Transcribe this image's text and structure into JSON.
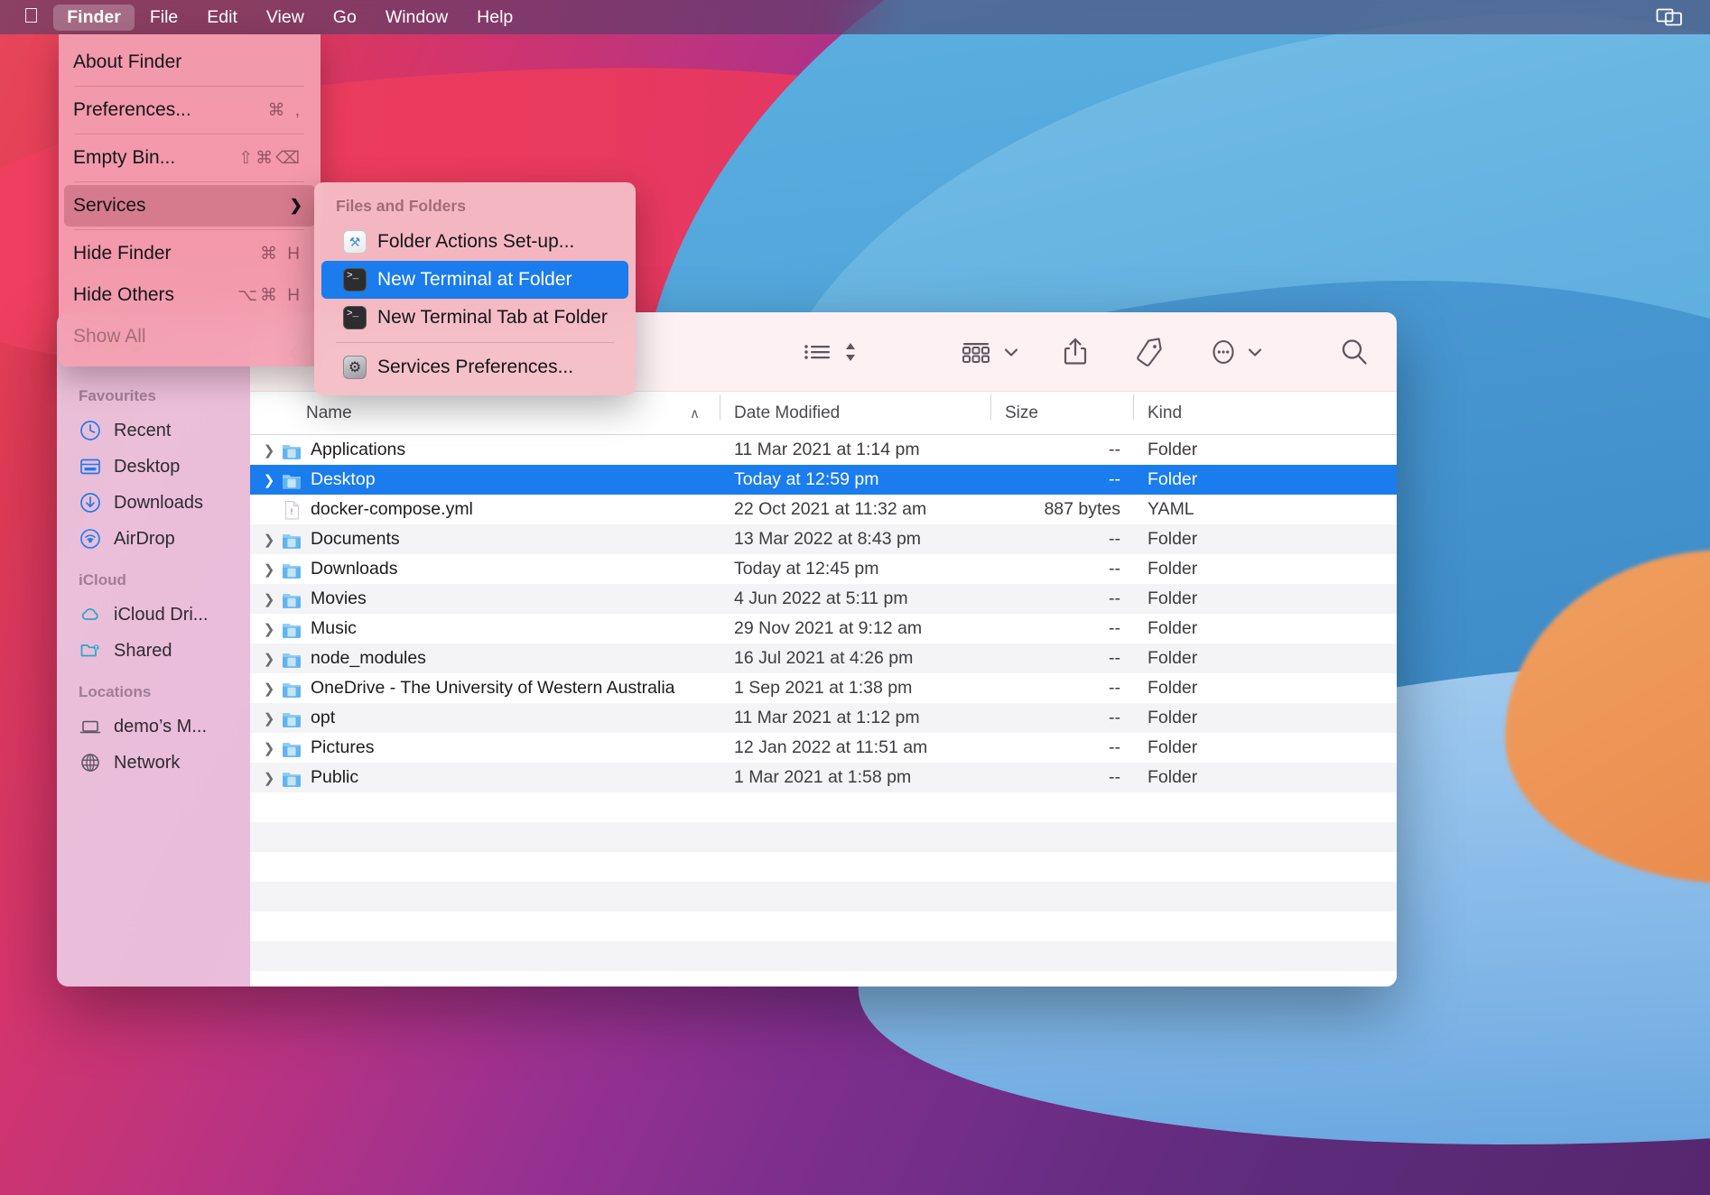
{
  "menubar": {
    "apple_icon": "apple-logo",
    "items": [
      {
        "label": "Finder",
        "bold": true,
        "active": true
      },
      {
        "label": "File",
        "bold": false,
        "active": false
      },
      {
        "label": "Edit",
        "bold": false,
        "active": false
      },
      {
        "label": "View",
        "bold": false,
        "active": false
      },
      {
        "label": "Go",
        "bold": false,
        "active": false
      },
      {
        "label": "Window",
        "bold": false,
        "active": false
      },
      {
        "label": "Help",
        "bold": false,
        "active": false
      }
    ],
    "status_icon": "screen-mirroring-icon"
  },
  "finder_menu": {
    "items": [
      {
        "label": "About Finder",
        "shortcut": "",
        "state": "normal",
        "submenu": false
      },
      {
        "sep": true
      },
      {
        "label": "Preferences...",
        "shortcut": "⌘ ,",
        "state": "normal",
        "submenu": false
      },
      {
        "sep": true
      },
      {
        "label": "Empty Bin...",
        "shortcut": "⇧⌘⌫",
        "state": "normal",
        "submenu": false
      },
      {
        "sep": true
      },
      {
        "label": "Services",
        "shortcut": "",
        "state": "highlighted",
        "submenu": true
      },
      {
        "sep": true
      },
      {
        "label": "Hide Finder",
        "shortcut": "⌘ H",
        "state": "normal",
        "submenu": false
      },
      {
        "label": "Hide Others",
        "shortcut": "⌥⌘ H",
        "state": "normal",
        "submenu": false
      },
      {
        "label": "Show All",
        "shortcut": "",
        "state": "disabled",
        "submenu": false
      }
    ]
  },
  "services_menu": {
    "section_title": "Files and Folders",
    "items": [
      {
        "label": "Folder Actions Set-up...",
        "icon": "folder-actions-icon",
        "selected": false
      },
      {
        "label": "New Terminal at Folder",
        "icon": "terminal-icon",
        "selected": true
      },
      {
        "label": "New Terminal Tab at Folder",
        "icon": "terminal-icon",
        "selected": false
      }
    ],
    "preferences": {
      "label": "Services Preferences...",
      "icon": "gear-icon"
    }
  },
  "window": {
    "traffic_lights": [
      "close",
      "minimise",
      "zoom"
    ],
    "toolbar": {
      "back_label": "‹",
      "icons": [
        {
          "name": "list-view-icon"
        },
        {
          "name": "sort-arrows-icon"
        },
        {
          "name": "group-by-icon"
        },
        {
          "name": "chevron-down-icon"
        },
        {
          "name": "share-icon"
        },
        {
          "name": "tag-icon"
        },
        {
          "name": "more-actions-icon"
        },
        {
          "name": "chevron-down-icon"
        },
        {
          "name": "search-icon"
        }
      ]
    }
  },
  "sidebar": {
    "sections": [
      {
        "title": "Favourites",
        "items": [
          {
            "label": "Recent",
            "icon": "clock-icon"
          },
          {
            "label": "Desktop",
            "icon": "desktop-icon"
          },
          {
            "label": "Downloads",
            "icon": "download-icon"
          },
          {
            "label": "AirDrop",
            "icon": "airdrop-icon"
          }
        ]
      },
      {
        "title": "iCloud",
        "items": [
          {
            "label": "iCloud Dri...",
            "icon": "cloud-icon"
          },
          {
            "label": "Shared",
            "icon": "shared-folder-icon"
          }
        ]
      },
      {
        "title": "Locations",
        "items": [
          {
            "label": "demo’s M...",
            "icon": "laptop-icon"
          },
          {
            "label": "Network",
            "icon": "globe-icon"
          }
        ]
      }
    ]
  },
  "filelist": {
    "columns": [
      "Name",
      "Date Modified",
      "Size",
      "Kind"
    ],
    "sort_indicator": "∧",
    "rows": [
      {
        "name": "Applications",
        "date": "11 Mar 2021 at 1:14 pm",
        "size": "--",
        "kind": "Folder",
        "icon": "folder-applications-icon",
        "expandable": true,
        "selected": false
      },
      {
        "name": "Desktop",
        "date": "Today at 12:59 pm",
        "size": "--",
        "kind": "Folder",
        "icon": "folder-desktop-icon",
        "expandable": true,
        "selected": true
      },
      {
        "name": "docker-compose.yml",
        "date": "22 Oct 2021 at 11:32 am",
        "size": "887 bytes",
        "kind": "YAML",
        "icon": "yaml-file-icon",
        "expandable": false,
        "selected": false
      },
      {
        "name": "Documents",
        "date": "13 Mar 2022 at 8:43 pm",
        "size": "--",
        "kind": "Folder",
        "icon": "folder-documents-icon",
        "expandable": true,
        "selected": false
      },
      {
        "name": "Downloads",
        "date": "Today at 12:45 pm",
        "size": "--",
        "kind": "Folder",
        "icon": "folder-downloads-icon",
        "expandable": true,
        "selected": false
      },
      {
        "name": "Movies",
        "date": "4 Jun 2022 at 5:11 pm",
        "size": "--",
        "kind": "Folder",
        "icon": "folder-movies-icon",
        "expandable": true,
        "selected": false
      },
      {
        "name": "Music",
        "date": "29 Nov 2021 at 9:12 am",
        "size": "--",
        "kind": "Folder",
        "icon": "folder-music-icon",
        "expandable": true,
        "selected": false
      },
      {
        "name": "node_modules",
        "date": "16 Jul 2021 at 4:26 pm",
        "size": "--",
        "kind": "Folder",
        "icon": "folder-icon",
        "expandable": true,
        "selected": false
      },
      {
        "name": "OneDrive - The University of Western Australia",
        "date": "1 Sep 2021 at 1:38 pm",
        "size": "--",
        "kind": "Folder",
        "icon": "folder-onedrive-icon",
        "expandable": true,
        "selected": false
      },
      {
        "name": "opt",
        "date": "11 Mar 2021 at 1:12 pm",
        "size": "--",
        "kind": "Folder",
        "icon": "folder-icon",
        "expandable": true,
        "selected": false
      },
      {
        "name": "Pictures",
        "date": "12 Jan 2022 at 11:51 am",
        "size": "--",
        "kind": "Folder",
        "icon": "folder-pictures-icon",
        "expandable": true,
        "selected": false
      },
      {
        "name": "Public",
        "date": "1 Mar 2021 at 1:58 pm",
        "size": "--",
        "kind": "Folder",
        "icon": "folder-public-icon",
        "expandable": true,
        "selected": false
      }
    ]
  },
  "colors": {
    "selection_blue": "#1a7ced",
    "menu_pink": "#f3a0b2",
    "sidebar_pink": "#ecc8e2",
    "folder_blue": "#5aaee8"
  }
}
